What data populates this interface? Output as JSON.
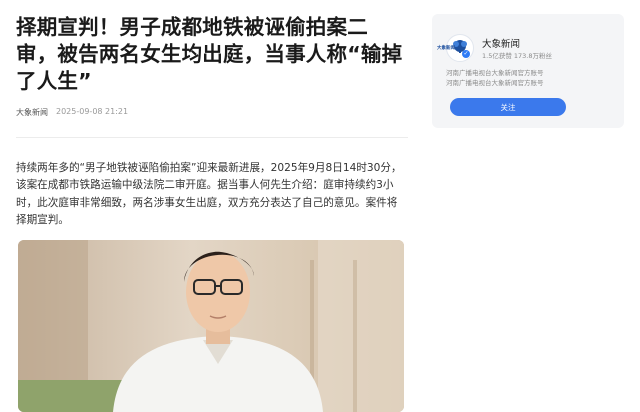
{
  "article": {
    "headline": "择期宣判！男子成都地铁被诬偷拍案二审，被告两名女生均出庭，当事人称“输掉了人生”",
    "source": "大象新闻",
    "timestamp": "2025-09-08 21:21",
    "body": "持续两年多的“男子地铁被诬陷偷拍案”迎来最新进展，2025年9月8日14时30分，该案在成都市铁路运输中级法院二审开庭。据当事人何先生介绍：庭审持续约3小时，此次庭审非常细致，两名涉事女生出庭，双方充分表达了自己的意见。案件将择期宣判。"
  },
  "author_card": {
    "avatar_label": "大象新闻",
    "name": "大象新闻",
    "stats": "1.5亿获赞 173.8万粉丝",
    "description": "河南广播电视台大象新闻官方账号\n河南广播电视台大象新闻官方账号",
    "follow_label": "关注"
  },
  "colors": {
    "accent": "#3b79ec",
    "card_bg": "#f4f5f7"
  }
}
